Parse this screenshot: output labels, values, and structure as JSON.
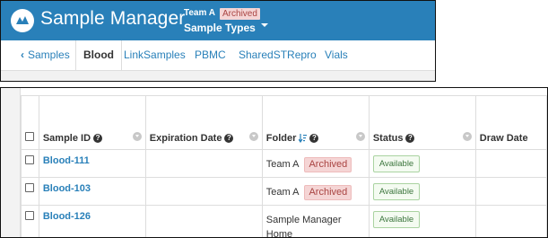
{
  "navbar": {
    "brand": "Sample Manager",
    "team": "Team A",
    "team_badge": "Archived",
    "project_menu": "Sample Types"
  },
  "tabs": {
    "back": "Samples",
    "items": [
      "Blood",
      "LinkSamples",
      "PBMC",
      "SharedSTRepro",
      "Vials"
    ],
    "active": "Blood"
  },
  "grid": {
    "columns": [
      "Sample ID",
      "Expiration Date",
      "Folder",
      "Status",
      "Draw Date"
    ],
    "rows": [
      {
        "sample_id": "Blood-111",
        "expiration": "",
        "folder": "Team A",
        "folder_badge": "Archived",
        "status": "Available",
        "draw_date": ""
      },
      {
        "sample_id": "Blood-103",
        "expiration": "",
        "folder": "Team A",
        "folder_badge": "Archived",
        "status": "Available",
        "draw_date": ""
      },
      {
        "sample_id": "Blood-126",
        "expiration": "",
        "folder": "Sample Manager Home",
        "folder_badge": "",
        "status": "Available",
        "draw_date": ""
      }
    ]
  },
  "colors": {
    "brand_blue": "#2980b9",
    "archived_bg": "#f5d5d5",
    "archived_text": "#a94442",
    "available_text": "#3c763d"
  },
  "icons": [
    "logo-icon",
    "chevron-left-icon",
    "caret-down-icon",
    "help-icon",
    "sort-descending-icon",
    "column-menu-icon",
    "checkbox"
  ]
}
